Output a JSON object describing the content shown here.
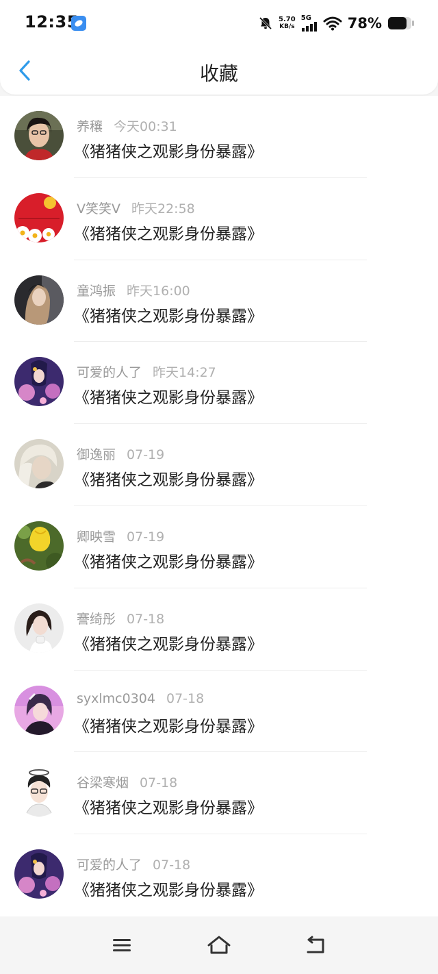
{
  "status_bar": {
    "time": "12:35",
    "net_speed_value": "5.70",
    "net_speed_unit": "KB/s",
    "network": "5G",
    "battery": "78%"
  },
  "header": {
    "title": "收藏"
  },
  "favorites": [
    {
      "user": "养穰",
      "time": "今天00:31",
      "title": "《猪猪侠之观影身份暴露》"
    },
    {
      "user": "V笑笑V",
      "time": "昨天22:58",
      "title": "《猪猪侠之观影身份暴露》"
    },
    {
      "user": "童鸿振",
      "time": "昨天16:00",
      "title": "《猪猪侠之观影身份暴露》"
    },
    {
      "user": "可爱的人了",
      "time": "昨天14:27",
      "title": "《猪猪侠之观影身份暴露》"
    },
    {
      "user": "御逸丽",
      "time": "07-19",
      "title": "《猪猪侠之观影身份暴露》"
    },
    {
      "user": "卿映雪",
      "time": "07-19",
      "title": "《猪猪侠之观影身份暴露》"
    },
    {
      "user": "謇绮彤",
      "time": "07-18",
      "title": "《猪猪侠之观影身份暴露》"
    },
    {
      "user": "syxlmc0304",
      "time": "07-18",
      "title": "《猪猪侠之观影身份暴露》"
    },
    {
      "user": "谷梁寒烟",
      "time": "07-18",
      "title": "《猪猪侠之观影身份暴露》"
    },
    {
      "user": "可爱的人了",
      "time": "07-18",
      "title": "《猪猪侠之观影身份暴露》"
    }
  ],
  "colors": {
    "accent": "#2f9bea",
    "meta_text": "#9a9a9a",
    "title_text": "#222222"
  }
}
